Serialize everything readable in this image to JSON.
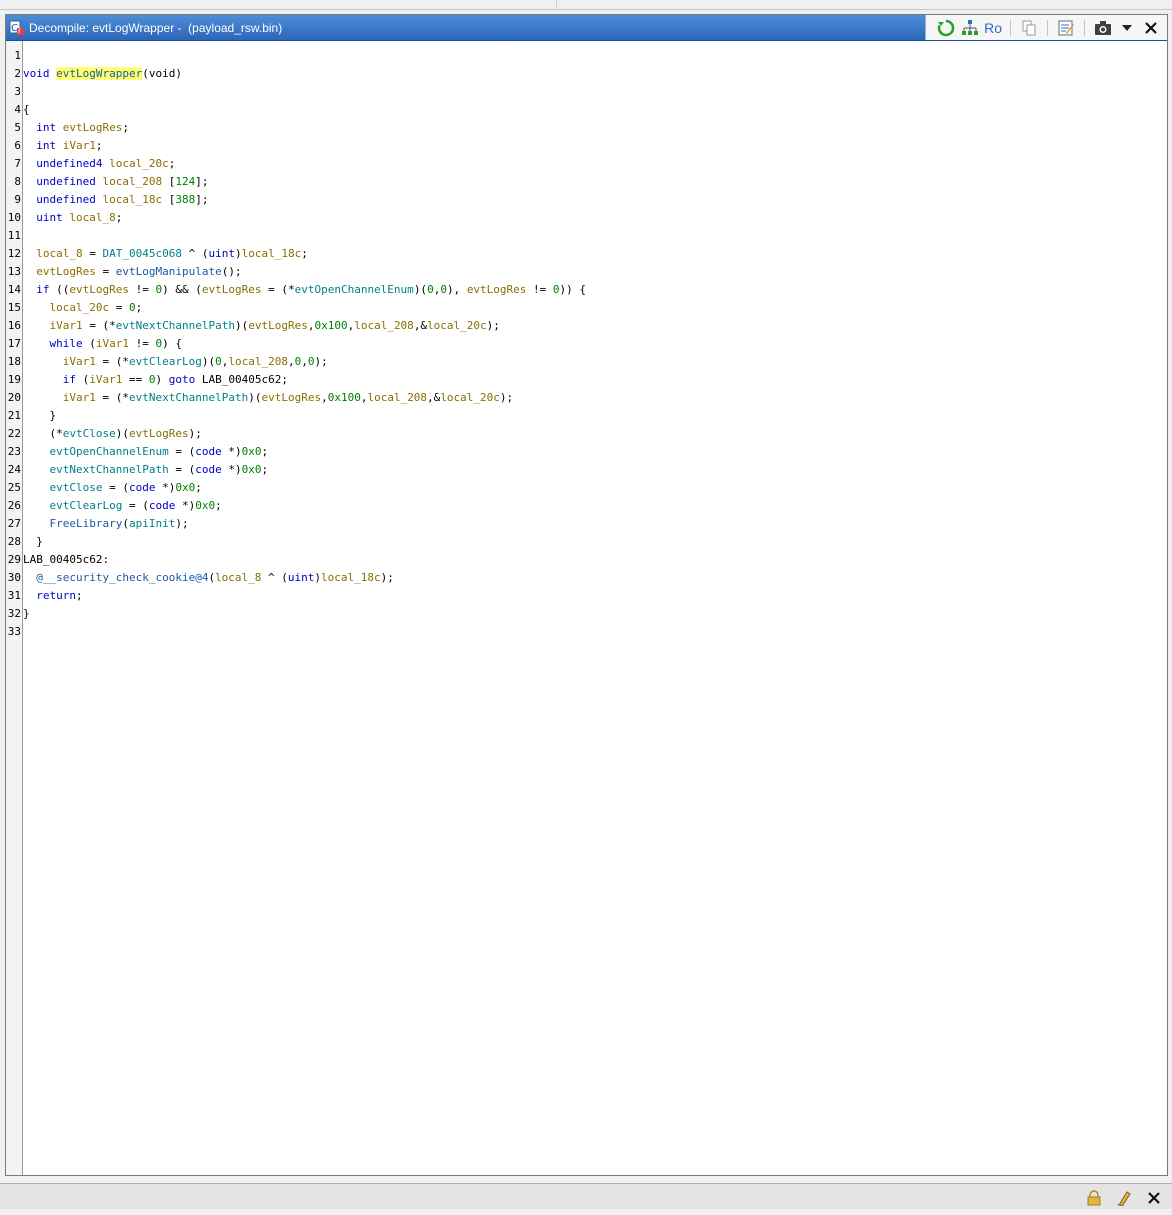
{
  "window": {
    "title": "Decompile: evtLogWrapper -  (payload_rsw.bin)",
    "ro_label": "Ro"
  },
  "code_lines": [
    {
      "n": "1",
      "tokens": []
    },
    {
      "n": "2",
      "tokens": [
        [
          "ty",
          "void"
        ],
        [
          "plain",
          " "
        ],
        [
          "fn hl",
          "evtLogWrapper"
        ],
        [
          "plain",
          "(void)"
        ]
      ]
    },
    {
      "n": "3",
      "tokens": []
    },
    {
      "n": "4",
      "tokens": [
        [
          "plain",
          "{"
        ]
      ]
    },
    {
      "n": "5",
      "tokens": [
        [
          "plain",
          "  "
        ],
        [
          "ty",
          "int"
        ],
        [
          "plain",
          " "
        ],
        [
          "var",
          "evtLogRes"
        ],
        [
          "plain",
          ";"
        ]
      ]
    },
    {
      "n": "6",
      "tokens": [
        [
          "plain",
          "  "
        ],
        [
          "ty",
          "int"
        ],
        [
          "plain",
          " "
        ],
        [
          "var",
          "iVar1"
        ],
        [
          "plain",
          ";"
        ]
      ]
    },
    {
      "n": "7",
      "tokens": [
        [
          "plain",
          "  "
        ],
        [
          "ty",
          "undefined4"
        ],
        [
          "plain",
          " "
        ],
        [
          "var",
          "local_20c"
        ],
        [
          "plain",
          ";"
        ]
      ]
    },
    {
      "n": "8",
      "tokens": [
        [
          "plain",
          "  "
        ],
        [
          "ty",
          "undefined"
        ],
        [
          "plain",
          " "
        ],
        [
          "var",
          "local_208"
        ],
        [
          "plain",
          " ["
        ],
        [
          "num",
          "124"
        ],
        [
          "plain",
          "];"
        ]
      ]
    },
    {
      "n": "9",
      "tokens": [
        [
          "plain",
          "  "
        ],
        [
          "ty",
          "undefined"
        ],
        [
          "plain",
          " "
        ],
        [
          "var",
          "local_18c"
        ],
        [
          "plain",
          " ["
        ],
        [
          "num",
          "388"
        ],
        [
          "plain",
          "];"
        ]
      ]
    },
    {
      "n": "10",
      "tokens": [
        [
          "plain",
          "  "
        ],
        [
          "ty",
          "uint"
        ],
        [
          "plain",
          " "
        ],
        [
          "var",
          "local_8"
        ],
        [
          "plain",
          ";"
        ]
      ]
    },
    {
      "n": "11",
      "tokens": []
    },
    {
      "n": "12",
      "tokens": [
        [
          "plain",
          "  "
        ],
        [
          "var",
          "local_8"
        ],
        [
          "plain",
          " = "
        ],
        [
          "glob",
          "DAT_0045c068"
        ],
        [
          "plain",
          " ^ ("
        ],
        [
          "ty",
          "uint"
        ],
        [
          "plain",
          ")"
        ],
        [
          "var",
          "local_18c"
        ],
        [
          "plain",
          ";"
        ]
      ]
    },
    {
      "n": "13",
      "tokens": [
        [
          "plain",
          "  "
        ],
        [
          "var",
          "evtLogRes"
        ],
        [
          "plain",
          " = "
        ],
        [
          "fn",
          "evtLogManipulate"
        ],
        [
          "plain",
          "();"
        ]
      ]
    },
    {
      "n": "14",
      "tokens": [
        [
          "plain",
          "  "
        ],
        [
          "kw",
          "if"
        ],
        [
          "plain",
          " (("
        ],
        [
          "var",
          "evtLogRes"
        ],
        [
          "plain",
          " != "
        ],
        [
          "num",
          "0"
        ],
        [
          "plain",
          ") && ("
        ],
        [
          "var",
          "evtLogRes"
        ],
        [
          "plain",
          " = (*"
        ],
        [
          "glob",
          "evtOpenChannelEnum"
        ],
        [
          "plain",
          ")("
        ],
        [
          "num",
          "0"
        ],
        [
          "plain",
          ","
        ],
        [
          "num",
          "0"
        ],
        [
          "plain",
          "), "
        ],
        [
          "var",
          "evtLogRes"
        ],
        [
          "plain",
          " != "
        ],
        [
          "num",
          "0"
        ],
        [
          "plain",
          ")) {"
        ]
      ]
    },
    {
      "n": "15",
      "tokens": [
        [
          "plain",
          "    "
        ],
        [
          "var",
          "local_20c"
        ],
        [
          "plain",
          " = "
        ],
        [
          "num",
          "0"
        ],
        [
          "plain",
          ";"
        ]
      ]
    },
    {
      "n": "16",
      "tokens": [
        [
          "plain",
          "    "
        ],
        [
          "var",
          "iVar1"
        ],
        [
          "plain",
          " = (*"
        ],
        [
          "glob",
          "evtNextChannelPath"
        ],
        [
          "plain",
          ")("
        ],
        [
          "var",
          "evtLogRes"
        ],
        [
          "plain",
          ","
        ],
        [
          "num",
          "0x100"
        ],
        [
          "plain",
          ","
        ],
        [
          "var",
          "local_208"
        ],
        [
          "plain",
          ",&"
        ],
        [
          "var",
          "local_20c"
        ],
        [
          "plain",
          ");"
        ]
      ]
    },
    {
      "n": "17",
      "tokens": [
        [
          "plain",
          "    "
        ],
        [
          "kw",
          "while"
        ],
        [
          "plain",
          " ("
        ],
        [
          "var",
          "iVar1"
        ],
        [
          "plain",
          " != "
        ],
        [
          "num",
          "0"
        ],
        [
          "plain",
          ") {"
        ]
      ]
    },
    {
      "n": "18",
      "tokens": [
        [
          "plain",
          "      "
        ],
        [
          "var",
          "iVar1"
        ],
        [
          "plain",
          " = (*"
        ],
        [
          "glob",
          "evtClearLog"
        ],
        [
          "plain",
          ")("
        ],
        [
          "num",
          "0"
        ],
        [
          "plain",
          ","
        ],
        [
          "var",
          "local_208"
        ],
        [
          "plain",
          ","
        ],
        [
          "num",
          "0"
        ],
        [
          "plain",
          ","
        ],
        [
          "num",
          "0"
        ],
        [
          "plain",
          ");"
        ]
      ]
    },
    {
      "n": "19",
      "tokens": [
        [
          "plain",
          "      "
        ],
        [
          "kw",
          "if"
        ],
        [
          "plain",
          " ("
        ],
        [
          "var",
          "iVar1"
        ],
        [
          "plain",
          " == "
        ],
        [
          "num",
          "0"
        ],
        [
          "plain",
          ") "
        ],
        [
          "kw",
          "goto"
        ],
        [
          "plain",
          " LAB_00405c62;"
        ]
      ]
    },
    {
      "n": "20",
      "tokens": [
        [
          "plain",
          "      "
        ],
        [
          "var",
          "iVar1"
        ],
        [
          "plain",
          " = (*"
        ],
        [
          "glob",
          "evtNextChannelPath"
        ],
        [
          "plain",
          ")("
        ],
        [
          "var",
          "evtLogRes"
        ],
        [
          "plain",
          ","
        ],
        [
          "num",
          "0x100"
        ],
        [
          "plain",
          ","
        ],
        [
          "var",
          "local_208"
        ],
        [
          "plain",
          ",&"
        ],
        [
          "var",
          "local_20c"
        ],
        [
          "plain",
          ");"
        ]
      ]
    },
    {
      "n": "21",
      "tokens": [
        [
          "plain",
          "    }"
        ]
      ]
    },
    {
      "n": "22",
      "tokens": [
        [
          "plain",
          "    (*"
        ],
        [
          "glob",
          "evtClose"
        ],
        [
          "plain",
          ")("
        ],
        [
          "var",
          "evtLogRes"
        ],
        [
          "plain",
          ");"
        ]
      ]
    },
    {
      "n": "23",
      "tokens": [
        [
          "plain",
          "    "
        ],
        [
          "glob",
          "evtOpenChannelEnum"
        ],
        [
          "plain",
          " = ("
        ],
        [
          "ty",
          "code"
        ],
        [
          "plain",
          " *)"
        ],
        [
          "num",
          "0x0"
        ],
        [
          "plain",
          ";"
        ]
      ]
    },
    {
      "n": "24",
      "tokens": [
        [
          "plain",
          "    "
        ],
        [
          "glob",
          "evtNextChannelPath"
        ],
        [
          "plain",
          " = ("
        ],
        [
          "ty",
          "code"
        ],
        [
          "plain",
          " *)"
        ],
        [
          "num",
          "0x0"
        ],
        [
          "plain",
          ";"
        ]
      ]
    },
    {
      "n": "25",
      "tokens": [
        [
          "plain",
          "    "
        ],
        [
          "glob",
          "evtClose"
        ],
        [
          "plain",
          " = ("
        ],
        [
          "ty",
          "code"
        ],
        [
          "plain",
          " *)"
        ],
        [
          "num",
          "0x0"
        ],
        [
          "plain",
          ";"
        ]
      ]
    },
    {
      "n": "26",
      "tokens": [
        [
          "plain",
          "    "
        ],
        [
          "glob",
          "evtClearLog"
        ],
        [
          "plain",
          " = ("
        ],
        [
          "ty",
          "code"
        ],
        [
          "plain",
          " *)"
        ],
        [
          "num",
          "0x0"
        ],
        [
          "plain",
          ";"
        ]
      ]
    },
    {
      "n": "27",
      "tokens": [
        [
          "plain",
          "    "
        ],
        [
          "fn",
          "FreeLibrary"
        ],
        [
          "plain",
          "("
        ],
        [
          "glob",
          "apiInit"
        ],
        [
          "plain",
          ");"
        ]
      ]
    },
    {
      "n": "28",
      "tokens": [
        [
          "plain",
          "  }"
        ]
      ]
    },
    {
      "n": "29",
      "tokens": [
        [
          "plain",
          "LAB_00405c62:"
        ]
      ]
    },
    {
      "n": "30",
      "tokens": [
        [
          "plain",
          "  "
        ],
        [
          "fn",
          "@__security_check_cookie@4"
        ],
        [
          "plain",
          "("
        ],
        [
          "var",
          "local_8"
        ],
        [
          "plain",
          " ^ ("
        ],
        [
          "ty",
          "uint"
        ],
        [
          "plain",
          ")"
        ],
        [
          "var",
          "local_18c"
        ],
        [
          "plain",
          ");"
        ]
      ]
    },
    {
      "n": "31",
      "tokens": [
        [
          "plain",
          "  "
        ],
        [
          "kw",
          "return"
        ],
        [
          "plain",
          ";"
        ]
      ]
    },
    {
      "n": "32",
      "tokens": [
        [
          "plain",
          "}"
        ]
      ]
    },
    {
      "n": "33",
      "tokens": []
    }
  ],
  "toolbar_icons": [
    "refresh-icon",
    "graph-icon",
    "copy-icon",
    "edit-icon",
    "snapshot-icon",
    "dropdown-icon",
    "close-icon"
  ],
  "bottom_icons": [
    "lock-icon",
    "eraser-icon",
    "close-icon"
  ]
}
